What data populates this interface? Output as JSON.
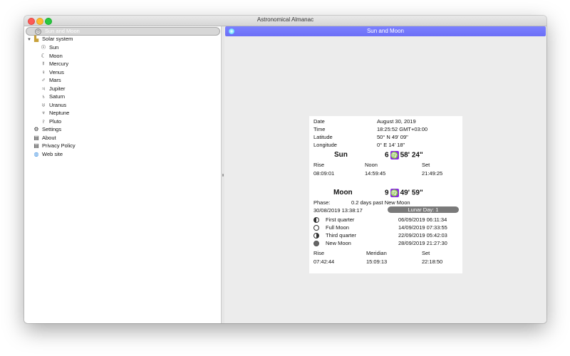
{
  "window": {
    "title": "Astronomical Almanac"
  },
  "sidebar": {
    "selected": "Sun and Moon",
    "group": "Solar system",
    "planets": [
      {
        "label": "Sun",
        "icon": "sun-icon",
        "glyph": "☉"
      },
      {
        "label": "Moon",
        "icon": "moon-icon",
        "glyph": "☾"
      },
      {
        "label": "Mercury",
        "icon": "mercury-icon",
        "glyph": "☿"
      },
      {
        "label": "Venus",
        "icon": "venus-icon",
        "glyph": "♀"
      },
      {
        "label": "Mars",
        "icon": "mars-icon",
        "glyph": "♂"
      },
      {
        "label": "Jupiter",
        "icon": "jupiter-icon",
        "glyph": "♃"
      },
      {
        "label": "Saturn",
        "icon": "saturn-icon",
        "glyph": "♄"
      },
      {
        "label": "Uranus",
        "icon": "uranus-icon",
        "glyph": "♅"
      },
      {
        "label": "Neptune",
        "icon": "neptune-icon",
        "glyph": "♆"
      },
      {
        "label": "Pluto",
        "icon": "pluto-icon",
        "glyph": "♇"
      }
    ],
    "extras": [
      {
        "label": "Settings",
        "icon": "gear-icon",
        "glyph": "⚙"
      },
      {
        "label": "About",
        "icon": "document-icon",
        "glyph": "▤"
      },
      {
        "label": "Privacy Policy",
        "icon": "document-icon",
        "glyph": "▤"
      },
      {
        "label": "Web site",
        "icon": "globe-icon",
        "glyph": "◍"
      }
    ]
  },
  "header": {
    "title": "Sun and Moon"
  },
  "info": {
    "date_label": "Date",
    "date": "August 30, 2019",
    "time_label": "Time",
    "time": "18:25:52 GMT+03:00",
    "lat_label": "Latitude",
    "lat": "50° N 49' 09\"",
    "lon_label": "Longitude",
    "lon": "0° E 14' 18\""
  },
  "sun": {
    "name": "Sun",
    "deg": "6",
    "sign": "♍",
    "arc": "58' 24\"",
    "rise_label": "Rise",
    "noon_label": "Noon",
    "set_label": "Set",
    "rise": "08:09:01",
    "noon": "14:59:45",
    "set": "21:49:25"
  },
  "moon": {
    "name": "Moon",
    "deg": "9",
    "sign": "♍",
    "arc": "49' 59\"",
    "phase_label": "Phase:",
    "phase": "0.2 days past New Moon",
    "datetime": "30/08/2019 13:38:17",
    "lunar_day": "Lunar Day: 1",
    "phases": [
      {
        "label": "First quarter",
        "date": "06/09/2019 06:11:34"
      },
      {
        "label": "Full Moon",
        "date": "14/09/2019 07:33:55"
      },
      {
        "label": "Third quarter",
        "date": "22/09/2019 05:42:03"
      },
      {
        "label": "New Moon",
        "date": "28/09/2019 21:27:30"
      }
    ],
    "rise_label": "Rise",
    "meridian_label": "Meridian",
    "set_label": "Set",
    "rise": "07:42:44",
    "meridian": "15:09:13",
    "set": "22:18:50"
  }
}
